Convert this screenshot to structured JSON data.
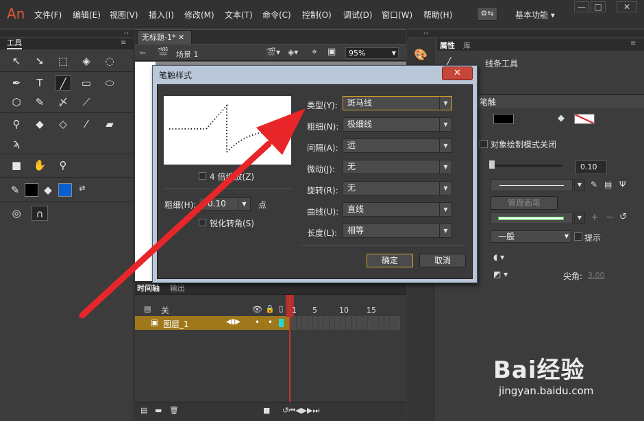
{
  "app": {
    "logo": "An"
  },
  "menu": [
    "文件(F)",
    "编辑(E)",
    "视图(V)",
    "插入(I)",
    "修改(M)",
    "文本(T)",
    "命令(C)",
    "控制(O)",
    "调试(D)",
    "窗口(W)",
    "帮助(H)"
  ],
  "workspace": {
    "label": "基本功能"
  },
  "tools_panel": {
    "title": "工具"
  },
  "document": {
    "tab": "无标题-1*",
    "scene": "场景 1",
    "zoom": "95%"
  },
  "timeline": {
    "tab": "时间轴",
    "tab2": "输出",
    "guide_layer": "关",
    "layer": "图层_1",
    "frame_numbers": [
      "1",
      "5",
      "10",
      "15"
    ]
  },
  "properties": {
    "tab": "属性",
    "tab2": "库",
    "tool_name": "线条工具",
    "section": "笔触",
    "object_draw": "对象绘制模式关闭",
    "stroke_size": "0.10",
    "manage_brush": "管理画笔",
    "scale": "一般",
    "hint": "提示",
    "miter_label": "尖角",
    "miter_value": "3.00"
  },
  "dialog": {
    "title": "笔触样式",
    "zoom4x": "4 倍缩放(Z)",
    "thickness_label": "粗细(H):",
    "thickness_value": "0.10",
    "thickness_unit": "点",
    "sharpen": "锐化转角(S)",
    "fields": [
      {
        "label": "类型(Y):",
        "value": "斑马线"
      },
      {
        "label": "粗细(N):",
        "value": "极细线"
      },
      {
        "label": "间隔(A):",
        "value": "远"
      },
      {
        "label": "微动(J):",
        "value": "无"
      },
      {
        "label": "旋转(R):",
        "value": "无"
      },
      {
        "label": "曲线(U):",
        "value": "直线"
      },
      {
        "label": "长度(L):",
        "value": "相等"
      }
    ],
    "ok": "确定",
    "cancel": "取消"
  },
  "watermark": {
    "brand": "Bai经验",
    "url": "jingyan.baidu.com"
  },
  "colors": {
    "accent": "#d9a52b",
    "arrow": "#e8262a",
    "layer": "#a0781c"
  }
}
